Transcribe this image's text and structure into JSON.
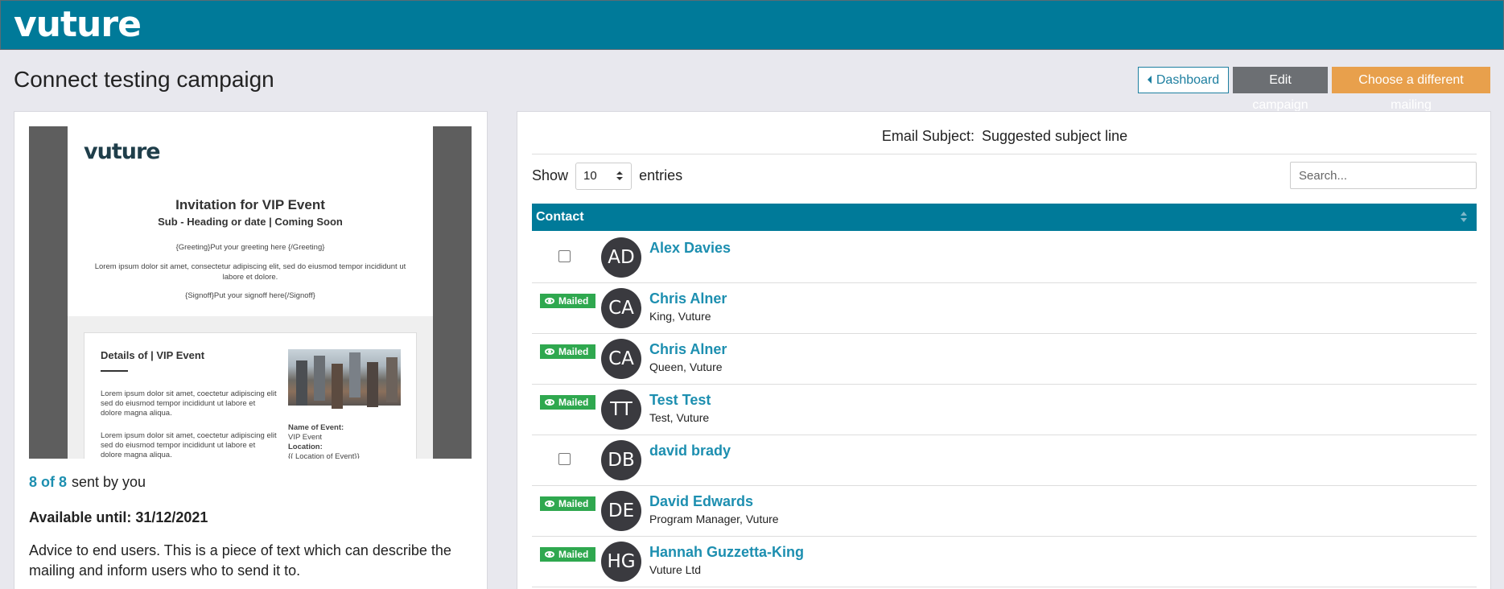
{
  "header": {
    "logo": "vuture"
  },
  "page": {
    "title": "Connect testing campaign"
  },
  "actions": {
    "dashboard": "Dashboard",
    "edit": "Edit campaign",
    "choose": "Choose a different mailing"
  },
  "preview": {
    "logo": "vuture",
    "heading": "Invitation for VIP Event",
    "subheading": "Sub - Heading or date | Coming Soon",
    "greeting": "{Greeting}Put your greeting here {/Greeting}",
    "body": "Lorem ipsum dolor sit amet, consectetur adipiscing elit, sed do eiusmod tempor incididunt ut labore et dolore.",
    "signoff": "{Signoff}Put your signoff here{/Signoff}",
    "card_title": "Details of | VIP Event",
    "card_text_1": "Lorem ipsum dolor sit amet, coectetur adipiscing elit sed do eiusmod tempor incididunt ut labore et dolore magna aliqua.",
    "card_text_2": "Lorem ipsum dolor sit amet, coectetur adipiscing elit sed do eiusmod tempor incididunt ut labore et dolore magna aliqua.",
    "meta_name_label": "Name of Event:",
    "meta_name_value": "VIP Event",
    "meta_location_label": "Location:",
    "meta_location_value": "{{ Location of Event}}"
  },
  "stats": {
    "count": "8 of 8",
    "sent_by": "sent by you"
  },
  "availability": "Available until: 31/12/2021",
  "advice": "Advice to end users.  This is a piece of text which can describe the mailing and inform users who to send it to.",
  "subject": {
    "label": "Email Subject:",
    "value": "Suggested subject line"
  },
  "entries": {
    "show": "Show",
    "value": "10",
    "suffix": "entries"
  },
  "search": {
    "placeholder": "Search..."
  },
  "table": {
    "header": "Contact",
    "rows": [
      {
        "initials": "AD",
        "name": "Alex Davies",
        "sub": "",
        "status": ""
      },
      {
        "initials": "CA",
        "name": "Chris Alner",
        "sub": "King, Vuture",
        "status": "Mailed"
      },
      {
        "initials": "CA",
        "name": "Chris Alner",
        "sub": "Queen, Vuture",
        "status": "Mailed"
      },
      {
        "initials": "TT",
        "name": "Test Test",
        "sub": "Test, Vuture",
        "status": "Mailed"
      },
      {
        "initials": "DB",
        "name": "david brady",
        "sub": "",
        "status": ""
      },
      {
        "initials": "DE",
        "name": "David Edwards",
        "sub": "Program Manager, Vuture",
        "status": "Mailed"
      },
      {
        "initials": "HG",
        "name": "Hannah Guzzetta-King",
        "sub": "Vuture Ltd",
        "status": "Mailed"
      }
    ]
  },
  "colors": {
    "brand": "#007a99",
    "accent": "#e8a04c",
    "mailed": "#2fa84f",
    "link": "#1d8fb0"
  }
}
